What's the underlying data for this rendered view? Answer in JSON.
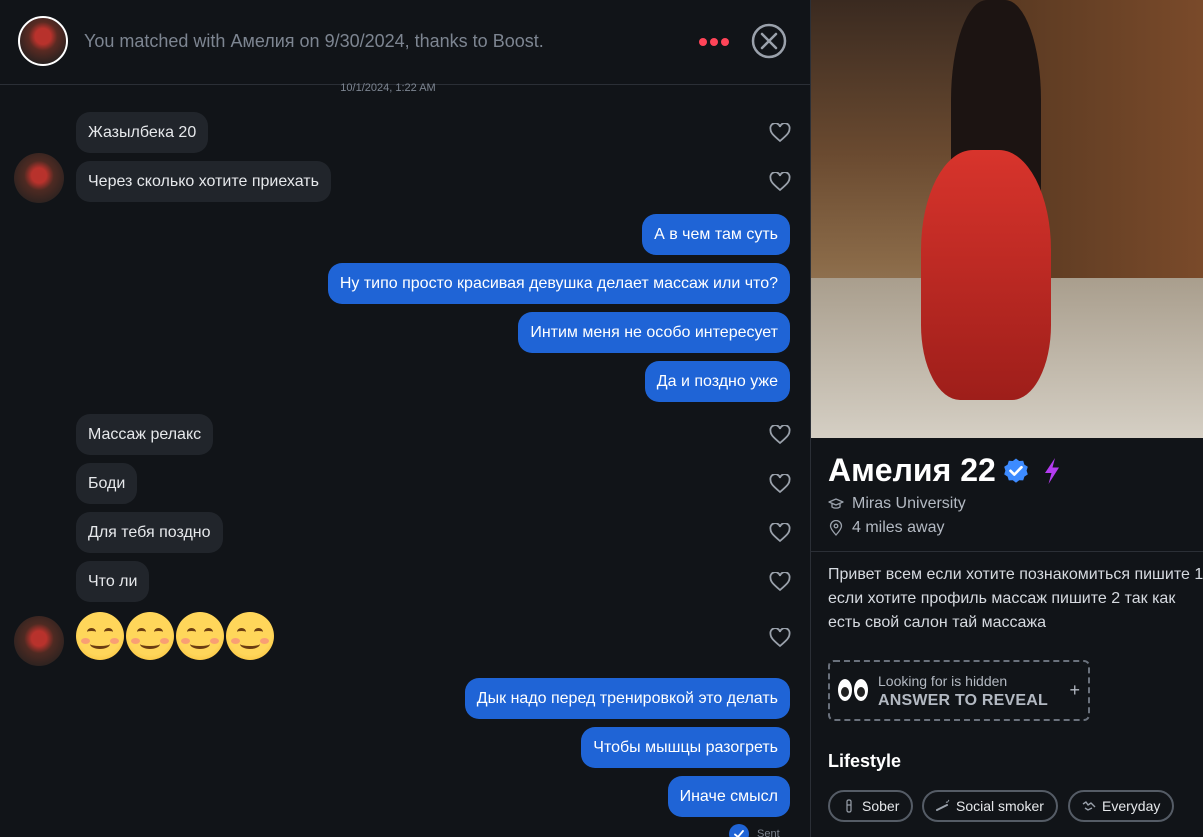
{
  "header": {
    "title_prefix": "You matched with ",
    "match_name": "Амелия",
    "title_suffix": " on 9/30/2024, thanks to Boost."
  },
  "conversation": {
    "timestamp": "10/1/2024, 1:22 AM",
    "messages": [
      {
        "dir": "in",
        "text": "Жазылбека 20"
      },
      {
        "dir": "in",
        "text": "Через сколько хотите приехать"
      },
      {
        "dir": "out",
        "text": "А в чем там суть"
      },
      {
        "dir": "out",
        "text": "Ну типо просто красивая девушка делает массаж или что?"
      },
      {
        "dir": "out",
        "text": "Интим меня не особо интересует"
      },
      {
        "dir": "out",
        "text": "Да и поздно уже"
      },
      {
        "dir": "in",
        "text": "Массаж релакс"
      },
      {
        "dir": "in",
        "text": "Боди"
      },
      {
        "dir": "in",
        "text": "Для тебя поздно"
      },
      {
        "dir": "in",
        "text": "Что ли"
      },
      {
        "dir": "in",
        "text": "😊😊😊😊"
      },
      {
        "dir": "out",
        "text": "Дык надо перед тренировкой это делать"
      },
      {
        "dir": "out",
        "text": "Чтобы мышцы разогреть"
      },
      {
        "dir": "out",
        "text": "Иначе смысл"
      }
    ],
    "status": "Sent"
  },
  "profile": {
    "name": "Амелия",
    "age": "22",
    "school": "Miras University",
    "distance": "4 miles away",
    "bio": "Привет всем если хотите познакомиться пишите 1 если хотите профиль массаж пишите 2 так как есть свой салон тай массажа",
    "looking_for": {
      "label": "Looking for is hidden",
      "cta": "ANSWER TO REVEAL"
    },
    "lifestyle_title": "Lifestyle",
    "lifestyle": [
      "Sober",
      "Social smoker",
      "Everyday"
    ]
  },
  "colors": {
    "background": "#111418",
    "outgoing_bubble": "#1f64d6",
    "incoming_bubble": "#21252b",
    "accent_red": "#ff4458",
    "verified_blue": "#3d8bff",
    "boost_purple": "#b43cf0"
  },
  "icons": [
    "options-icon",
    "close-icon",
    "heart-icon",
    "verified-icon",
    "boost-icon",
    "school-icon",
    "location-icon",
    "eyes-icon",
    "plus-icon",
    "sober-icon",
    "smoking-icon",
    "everyday-icon"
  ]
}
